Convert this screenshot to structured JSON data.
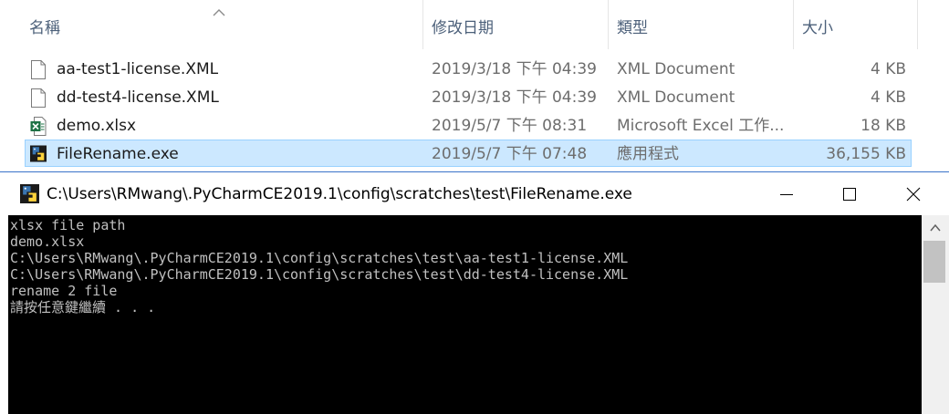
{
  "explorer": {
    "columns": {
      "name": "名稱",
      "modified": "修改日期",
      "type": "類型",
      "size": "大小"
    },
    "files": [
      {
        "name": "aa-test1-license.XML",
        "modified": "2019/3/18 下午 04:39",
        "type": "XML Document",
        "size": "4 KB",
        "icon": "xml-file-icon"
      },
      {
        "name": "dd-test4-license.XML",
        "modified": "2019/3/18 下午 04:39",
        "type": "XML Document",
        "size": "4 KB",
        "icon": "xml-file-icon"
      },
      {
        "name": "demo.xlsx",
        "modified": "2019/5/7 下午 08:31",
        "type": "Microsoft Excel 工作...",
        "size": "18 KB",
        "icon": "excel-file-icon"
      },
      {
        "name": "FileRename.exe",
        "modified": "2019/5/7 下午 07:48",
        "type": "應用程式",
        "size": "36,155 KB",
        "icon": "python-exe-icon",
        "selected": true
      }
    ]
  },
  "console": {
    "title": "C:\\Users\\RMwang\\.PyCharmCE2019.1\\config\\scratches\\test\\FileRename.exe",
    "lines": [
      "xlsx file path",
      "demo.xlsx",
      "C:\\Users\\RMwang\\.PyCharmCE2019.1\\config\\scratches\\test\\aa-test1-license.XML",
      "C:\\Users\\RMwang\\.PyCharmCE2019.1\\config\\scratches\\test\\dd-test4-license.XML",
      "rename 2 file",
      "請按任意鍵繼續 . . ."
    ]
  },
  "colors": {
    "selection_bg": "#cce8ff",
    "selection_border": "#99d1ff",
    "console_bg": "#000000",
    "console_text": "#c0c0c0",
    "header_text": "#4c607a"
  }
}
